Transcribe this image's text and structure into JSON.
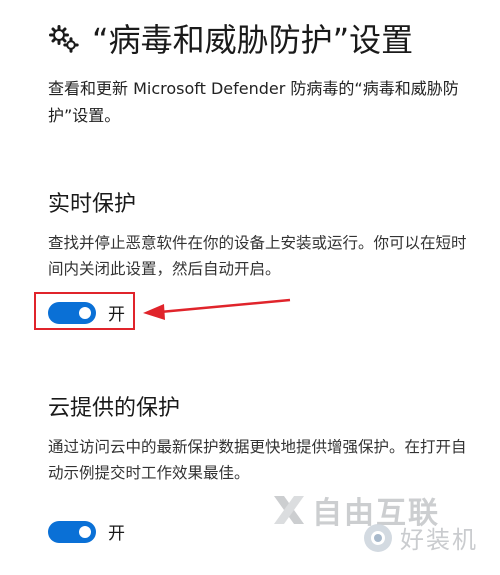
{
  "header": {
    "icon": "gear-icon",
    "title": "“病毒和威胁防护”设置"
  },
  "description": "查看和更新 Microsoft Defender 防病毒的“病毒和威胁防护”设置。",
  "realtime": {
    "title": "实时保护",
    "description": "查找并停止恶意软件在你的设备上安装或运行。你可以在短时间内关闭此设置，然后自动开启。",
    "toggle_state": "on",
    "toggle_label": "开"
  },
  "cloud": {
    "title": "云提供的保护",
    "description": "通过访问云中的最新保护数据更快地提供增强保护。在打开自动示例提交时工作效果最佳。",
    "toggle_state": "on",
    "toggle_label": "开"
  },
  "watermarks": {
    "brand_1": "自由互联",
    "brand_2": "好装机"
  },
  "colors": {
    "toggle_on": "#0a70d6",
    "annotation_red": "#e0242b"
  }
}
